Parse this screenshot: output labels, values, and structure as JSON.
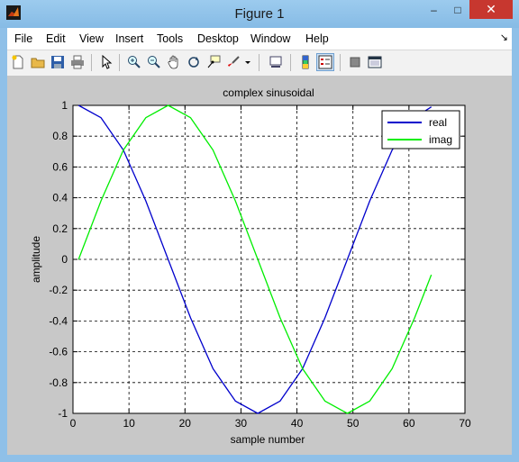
{
  "window": {
    "title": "Figure 1",
    "minimize_glyph": "–",
    "maximize_glyph": "□",
    "close_glyph": "✕"
  },
  "menu": [
    "File",
    "Edit",
    "View",
    "Insert",
    "Tools",
    "Desktop",
    "Window",
    "Help"
  ],
  "toolbar": {
    "icons": [
      "new-figure-icon",
      "open-file-icon",
      "save-icon",
      "print-icon",
      "edit-plot-pointer-icon",
      "zoom-in-icon",
      "zoom-out-icon",
      "pan-hand-icon",
      "rotate-3d-icon",
      "data-cursor-icon",
      "brush-icon",
      "link-plot-icon",
      "insert-colorbar-icon",
      "insert-legend-icon",
      "hide-plot-tools-icon",
      "show-plot-tools-icon"
    ]
  },
  "chart_data": {
    "type": "line",
    "title": "complex sinusoidal",
    "xlabel": "sample number",
    "ylabel": "amplitude",
    "xlim": [
      0,
      70
    ],
    "ylim": [
      -1,
      1
    ],
    "xticks": [
      0,
      10,
      20,
      30,
      40,
      50,
      60,
      70
    ],
    "yticks": [
      -1,
      -0.8,
      -0.6,
      -0.4,
      -0.2,
      0,
      0.2,
      0.4,
      0.6,
      0.8,
      1
    ],
    "grid": true,
    "grid_style": "dashed",
    "legend_position": "top-right",
    "series": [
      {
        "name": "real",
        "color": "#0000cc",
        "x": [
          1,
          5,
          9,
          13,
          17,
          21,
          25,
          29,
          33,
          37,
          41,
          45,
          49,
          53,
          57,
          61,
          64
        ],
        "y": [
          1.0,
          0.92,
          0.71,
          0.38,
          0.0,
          -0.38,
          -0.71,
          -0.92,
          -1.0,
          -0.92,
          -0.71,
          -0.38,
          0.0,
          0.38,
          0.71,
          0.92,
          0.99
        ]
      },
      {
        "name": "imag",
        "color": "#00ee00",
        "x": [
          1,
          5,
          9,
          13,
          17,
          21,
          25,
          29,
          33,
          37,
          41,
          45,
          49,
          53,
          57,
          61,
          64
        ],
        "y": [
          0.0,
          0.38,
          0.71,
          0.92,
          1.0,
          0.92,
          0.71,
          0.38,
          0.0,
          -0.38,
          -0.71,
          -0.92,
          -1.0,
          -0.92,
          -0.71,
          -0.38,
          -0.1
        ]
      }
    ]
  }
}
